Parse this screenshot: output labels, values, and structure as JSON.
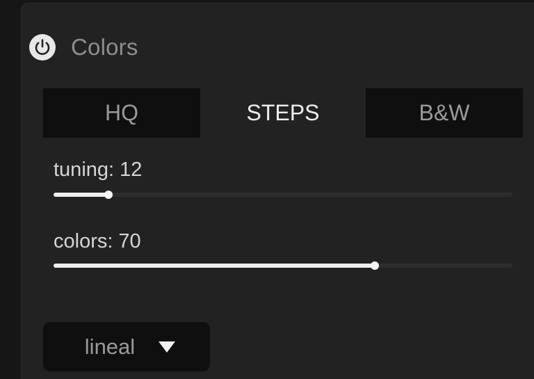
{
  "panel": {
    "title": "Colors",
    "power_icon": "power-icon"
  },
  "tabs": [
    {
      "label": "HQ",
      "active": false
    },
    {
      "label": "STEPS",
      "active": true
    },
    {
      "label": "B&W",
      "active": false
    }
  ],
  "sliders": {
    "tuning": {
      "name": "tuning",
      "value": "12",
      "fraction": 0.12
    },
    "colors": {
      "name": "colors",
      "value": "70",
      "fraction": 0.7
    }
  },
  "dropdown": {
    "value": "lineal",
    "icon": "caret-down-icon"
  },
  "colors": {
    "panel_bg": "#222222",
    "tab_inactive_bg": "#0f0f0f",
    "slider_fill": "#efefef"
  }
}
